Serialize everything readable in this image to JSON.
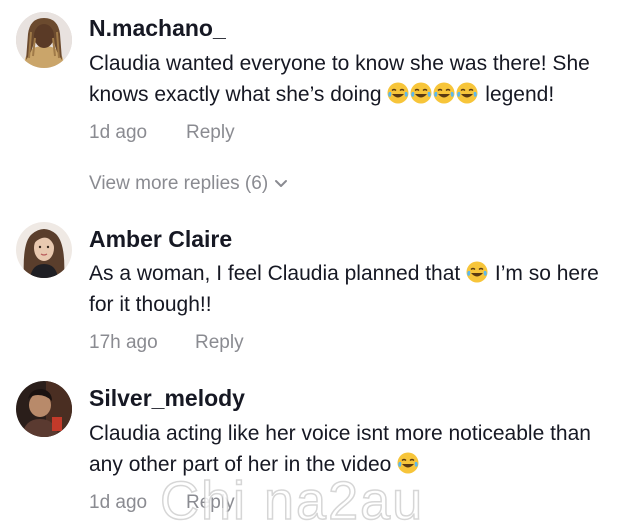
{
  "comments": [
    {
      "username": "N.machano_",
      "text_parts": [
        "Claudia wanted everyone to know she was there! She knows exactly what she’s doing ",
        " legend!"
      ],
      "emoji_count": 4,
      "time": "1d ago",
      "reply_label": "Reply"
    },
    {
      "username": "Amber Claire",
      "text_parts": [
        "As a woman, I feel Claudia planned that ",
        " I’m so here for it though!!"
      ],
      "emoji_count": 1,
      "time": "17h ago",
      "reply_label": "Reply"
    },
    {
      "username": "Silver_melody",
      "text_parts": [
        "Claudia acting like her voice isnt more noticeable than any other part of her in the video ",
        ""
      ],
      "emoji_count": 1,
      "time": "1d ago",
      "reply_label": "Reply"
    }
  ],
  "view_more": "View more replies (6)",
  "watermark": "Chi  na2au",
  "icons": {
    "emoji": "face-with-tears-of-joy-icon",
    "chevron": "chevron-down-icon"
  },
  "colors": {
    "text": "#161823",
    "meta": "#8a8b91",
    "emoji_face": "#f7c53a"
  }
}
